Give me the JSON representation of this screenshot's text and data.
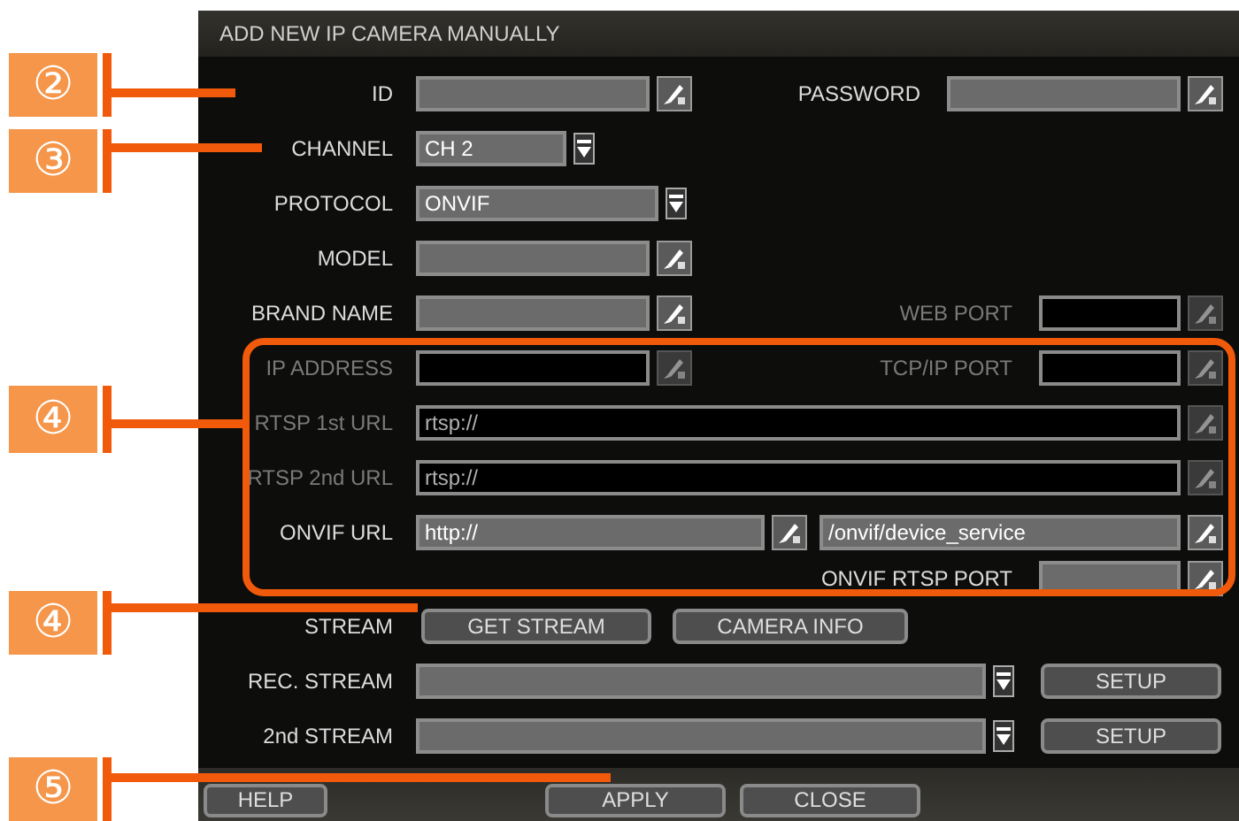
{
  "dialog": {
    "title": "ADD NEW IP CAMERA MANUALLY",
    "rows": [
      {
        "items": [
          {
            "kind": "label",
            "text": "ID",
            "disabled": false
          },
          {
            "kind": "field",
            "disabled": false
          },
          {
            "kind": "label",
            "text": "PASSWORD",
            "disabled": false
          },
          {
            "kind": "field",
            "disabled": false
          }
        ]
      },
      {
        "items": [
          {
            "kind": "label",
            "text": "CHANNEL",
            "disabled": false
          },
          {
            "kind": "dropdown",
            "value": "CH 2"
          }
        ]
      },
      {
        "items": [
          {
            "kind": "label",
            "text": "PROTOCOL",
            "disabled": false
          },
          {
            "kind": "dropdown",
            "value": "ONVIF"
          }
        ]
      },
      {
        "items": [
          {
            "kind": "label",
            "text": "MODEL",
            "disabled": false
          },
          {
            "kind": "field",
            "disabled": false
          }
        ]
      },
      {
        "items": [
          {
            "kind": "label",
            "text": "BRAND NAME",
            "disabled": false
          },
          {
            "kind": "field",
            "disabled": false
          },
          {
            "kind": "label",
            "text": "WEB PORT",
            "disabled": true
          },
          {
            "kind": "field",
            "disabled": true
          }
        ]
      },
      {
        "items": [
          {
            "kind": "label",
            "text": "IP ADDRESS",
            "disabled": true
          },
          {
            "kind": "field",
            "disabled": true
          },
          {
            "kind": "label",
            "text": "TCP/IP PORT",
            "disabled": true
          },
          {
            "kind": "field",
            "disabled": true
          }
        ]
      },
      {
        "items": [
          {
            "kind": "label",
            "text": "RTSP 1st URL",
            "disabled": true
          },
          {
            "kind": "field",
            "value": "rtsp://",
            "disabled": true
          }
        ]
      },
      {
        "items": [
          {
            "kind": "label",
            "text": "RTSP 2nd URL",
            "disabled": true
          },
          {
            "kind": "field",
            "value": "rtsp://",
            "disabled": true
          }
        ]
      },
      {
        "items": [
          {
            "kind": "label",
            "text": "ONVIF URL",
            "disabled": false
          },
          {
            "kind": "field",
            "value": "http://",
            "disabled": false
          },
          {
            "kind": "field",
            "value": "/onvif/device_service",
            "disabled": false
          }
        ]
      },
      {
        "items": [
          {
            "kind": "label",
            "text": "ONVIF RTSP PORT",
            "disabled": false
          },
          {
            "kind": "field",
            "disabled": false
          }
        ]
      },
      {
        "items": [
          {
            "kind": "label",
            "text": "STREAM",
            "disabled": false
          },
          {
            "kind": "button",
            "text": "GET STREAM"
          },
          {
            "kind": "button",
            "text": "CAMERA INFO"
          }
        ]
      },
      {
        "items": [
          {
            "kind": "label",
            "text": "REC. STREAM",
            "disabled": false
          },
          {
            "kind": "dropdown"
          },
          {
            "kind": "button",
            "text": "SETUP"
          }
        ]
      },
      {
        "items": [
          {
            "kind": "label",
            "text": "2nd STREAM",
            "disabled": false
          },
          {
            "kind": "dropdown"
          },
          {
            "kind": "button",
            "text": "SETUP"
          }
        ]
      }
    ],
    "footer_buttons": [
      "HELP",
      "APPLY",
      "CLOSE"
    ]
  },
  "callouts": [
    {
      "number": "②"
    },
    {
      "number": "③"
    },
    {
      "number": "④"
    },
    {
      "number": "④"
    },
    {
      "number": "⑤"
    }
  ]
}
